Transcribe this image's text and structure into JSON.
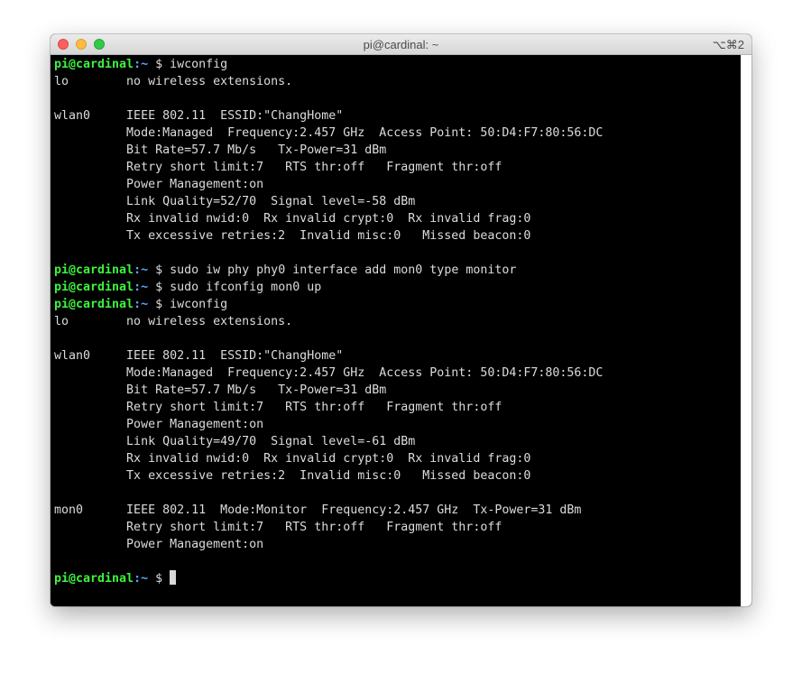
{
  "window": {
    "title": "pi@cardinal: ~",
    "shortcut": "⌥⌘2"
  },
  "prompt": {
    "user_host": "pi@cardinal",
    "sep_path": ":~ ",
    "symbol": "$ "
  },
  "lines": [
    {
      "type": "prompt",
      "cmd": "iwconfig"
    },
    {
      "type": "out",
      "text": "lo        no wireless extensions."
    },
    {
      "type": "out",
      "text": ""
    },
    {
      "type": "out",
      "text": "wlan0     IEEE 802.11  ESSID:\"ChangHome\""
    },
    {
      "type": "out",
      "text": "          Mode:Managed  Frequency:2.457 GHz  Access Point: 50:D4:F7:80:56:DC"
    },
    {
      "type": "out",
      "text": "          Bit Rate=57.7 Mb/s   Tx-Power=31 dBm"
    },
    {
      "type": "out",
      "text": "          Retry short limit:7   RTS thr:off   Fragment thr:off"
    },
    {
      "type": "out",
      "text": "          Power Management:on"
    },
    {
      "type": "out",
      "text": "          Link Quality=52/70  Signal level=-58 dBm"
    },
    {
      "type": "out",
      "text": "          Rx invalid nwid:0  Rx invalid crypt:0  Rx invalid frag:0"
    },
    {
      "type": "out",
      "text": "          Tx excessive retries:2  Invalid misc:0   Missed beacon:0"
    },
    {
      "type": "out",
      "text": ""
    },
    {
      "type": "prompt",
      "cmd": "sudo iw phy phy0 interface add mon0 type monitor"
    },
    {
      "type": "prompt",
      "cmd": "sudo ifconfig mon0 up"
    },
    {
      "type": "prompt",
      "cmd": "iwconfig"
    },
    {
      "type": "out",
      "text": "lo        no wireless extensions."
    },
    {
      "type": "out",
      "text": ""
    },
    {
      "type": "out",
      "text": "wlan0     IEEE 802.11  ESSID:\"ChangHome\""
    },
    {
      "type": "out",
      "text": "          Mode:Managed  Frequency:2.457 GHz  Access Point: 50:D4:F7:80:56:DC"
    },
    {
      "type": "out",
      "text": "          Bit Rate=57.7 Mb/s   Tx-Power=31 dBm"
    },
    {
      "type": "out",
      "text": "          Retry short limit:7   RTS thr:off   Fragment thr:off"
    },
    {
      "type": "out",
      "text": "          Power Management:on"
    },
    {
      "type": "out",
      "text": "          Link Quality=49/70  Signal level=-61 dBm"
    },
    {
      "type": "out",
      "text": "          Rx invalid nwid:0  Rx invalid crypt:0  Rx invalid frag:0"
    },
    {
      "type": "out",
      "text": "          Tx excessive retries:2  Invalid misc:0   Missed beacon:0"
    },
    {
      "type": "out",
      "text": ""
    },
    {
      "type": "out",
      "text": "mon0      IEEE 802.11  Mode:Monitor  Frequency:2.457 GHz  Tx-Power=31 dBm"
    },
    {
      "type": "out",
      "text": "          Retry short limit:7   RTS thr:off   Fragment thr:off"
    },
    {
      "type": "out",
      "text": "          Power Management:on"
    },
    {
      "type": "out",
      "text": ""
    },
    {
      "type": "prompt",
      "cmd": "",
      "cursor": true
    }
  ],
  "colors": {
    "terminal_bg": "#000000",
    "text": "#dcdcdc",
    "prompt_user": "#3ff23f",
    "prompt_path": "#5ba7ff"
  }
}
